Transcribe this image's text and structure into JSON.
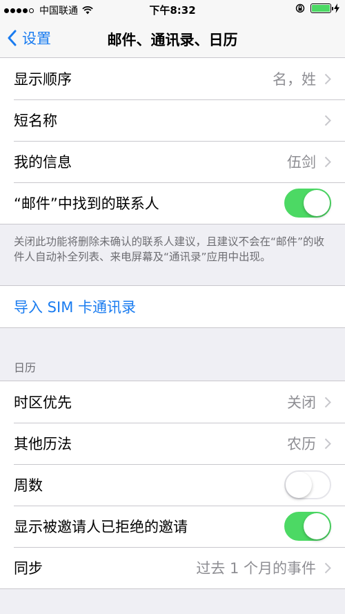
{
  "status_bar": {
    "carrier": "中国联通",
    "time": "下午8:32"
  },
  "nav": {
    "back_label": "设置",
    "title": "邮件、通讯录、日历"
  },
  "contacts": {
    "rows": [
      {
        "label": "显示顺序",
        "value": "名，姓"
      },
      {
        "label": "短名称",
        "value": ""
      },
      {
        "label": "我的信息",
        "value": "伍剑"
      }
    ],
    "found_in_mail_label": "“邮件”中找到的联系人",
    "found_in_mail_on": true,
    "footer": "关闭此功能将删除未确认的联系人建议，且建议不会在“邮件”的收件人自动补全列表、来电屏幕及“通讯录”应用中出现。"
  },
  "import_sim_label": "导入 SIM 卡通讯录",
  "calendar": {
    "header": "日历",
    "timezone_label": "时区优先",
    "timezone_value": "关闭",
    "alt_calendar_label": "其他历法",
    "alt_calendar_value": "农历",
    "week_numbers_label": "周数",
    "week_numbers_on": false,
    "declined_label": "显示被邀请人已拒绝的邀请",
    "declined_on": true,
    "sync_label": "同步",
    "sync_value": "过去 1 个月的事件"
  },
  "colors": {
    "accent": "#1a7cf0",
    "toggle_on": "#4cd964"
  }
}
